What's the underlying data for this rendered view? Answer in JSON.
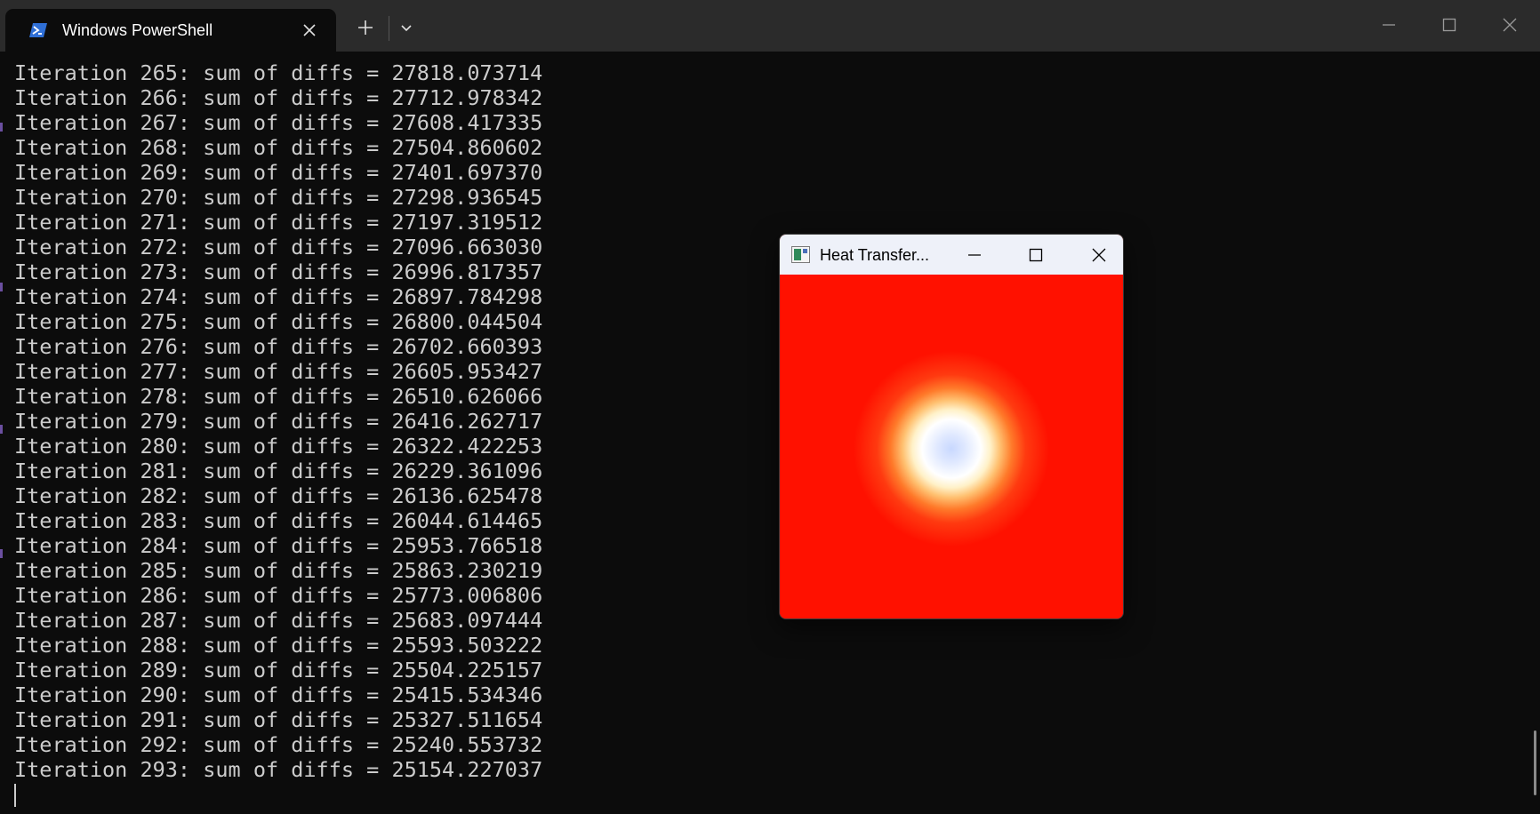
{
  "terminal": {
    "tab_title": "Windows PowerShell",
    "output_lines": [
      "Iteration 265: sum of diffs = 27818.073714",
      "Iteration 266: sum of diffs = 27712.978342",
      "Iteration 267: sum of diffs = 27608.417335",
      "Iteration 268: sum of diffs = 27504.860602",
      "Iteration 269: sum of diffs = 27401.697370",
      "Iteration 270: sum of diffs = 27298.936545",
      "Iteration 271: sum of diffs = 27197.319512",
      "Iteration 272: sum of diffs = 27096.663030",
      "Iteration 273: sum of diffs = 26996.817357",
      "Iteration 274: sum of diffs = 26897.784298",
      "Iteration 275: sum of diffs = 26800.044504",
      "Iteration 276: sum of diffs = 26702.660393",
      "Iteration 277: sum of diffs = 26605.953427",
      "Iteration 278: sum of diffs = 26510.626066",
      "Iteration 279: sum of diffs = 26416.262717",
      "Iteration 280: sum of diffs = 26322.422253",
      "Iteration 281: sum of diffs = 26229.361096",
      "Iteration 282: sum of diffs = 26136.625478",
      "Iteration 283: sum of diffs = 26044.614465",
      "Iteration 284: sum of diffs = 25953.766518",
      "Iteration 285: sum of diffs = 25863.230219",
      "Iteration 286: sum of diffs = 25773.006806",
      "Iteration 287: sum of diffs = 25683.097444",
      "Iteration 288: sum of diffs = 25593.503222",
      "Iteration 289: sum of diffs = 25504.225157",
      "Iteration 290: sum of diffs = 25415.534346",
      "Iteration 291: sum of diffs = 25327.511654",
      "Iteration 292: sum of diffs = 25240.553732",
      "Iteration 293: sum of diffs = 25154.227037"
    ]
  },
  "heat_window": {
    "title": "Heat Transfer..."
  },
  "colors": {
    "terminal_background": "#0c0c0c",
    "terminal_text": "#cccccc",
    "heat_field": "#ff1100",
    "heat_spot_core": "#c8d8ff"
  },
  "icons": {
    "tab_icon": "powershell-icon",
    "heat_app_icon": "app-window-icon"
  }
}
